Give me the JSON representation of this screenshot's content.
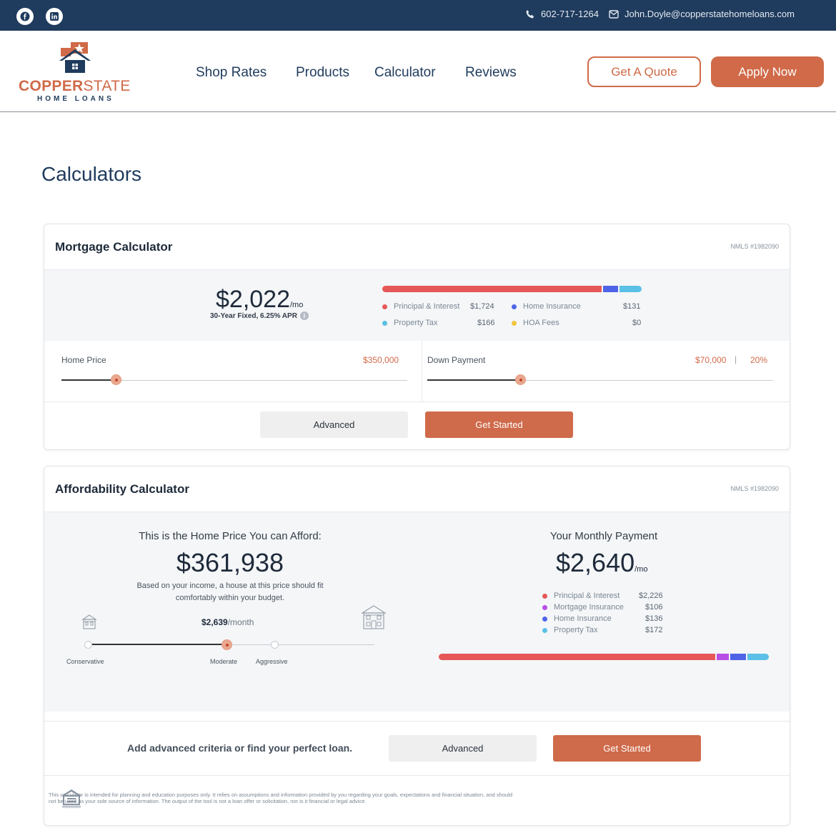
{
  "topbar": {
    "phone": "602-717-1264",
    "email": "John.Doyle@copperstatehomeloans.com"
  },
  "logo": {
    "brand_part1": "COPPER",
    "brand_part2": "STATE",
    "tagline": "HOME LOANS"
  },
  "nav": {
    "items": [
      "Shop Rates",
      "Products",
      "Calculator",
      "Reviews"
    ],
    "quote_label": "Get A Quote",
    "apply_label": "Apply Now"
  },
  "page_title": "Calculators",
  "mortgage": {
    "title": "Mortgage Calculator",
    "nmls": "NMLS #1982090",
    "payment": "$2,022",
    "payment_unit": "/mo",
    "loan_note": "30-Year Fixed, 6.25% APR",
    "breakdown": [
      {
        "label": "Principal & Interest",
        "value": "$1,724",
        "color": "#e65757"
      },
      {
        "label": "Property Tax",
        "value": "$166",
        "color": "#5bc0e6"
      },
      {
        "label": "Home Insurance",
        "value": "$131",
        "color": "#4f63e6"
      },
      {
        "label": "HOA Fees",
        "value": "$0",
        "color": "#f2c53d"
      }
    ],
    "home_price_label": "Home Price",
    "home_price_value": "$350,000",
    "home_price_slider": 0.16,
    "down_payment_label": "Down Payment",
    "down_payment_value": "$70,000",
    "down_payment_sep": "|",
    "down_payment_pct": "20%",
    "down_payment_slider": 0.27,
    "advanced_label": "Advanced",
    "start_label": "Get Started"
  },
  "affordability": {
    "title": "Affordability Calculator",
    "nmls": "NMLS #1982090",
    "afford_heading": "This is the Home Price You can Afford:",
    "afford_price": "$361,938",
    "afford_note": "Based on your income, a house at this price should fit comfortably within your budget.",
    "monthly_amount": "$2,639",
    "monthly_unit": "/month",
    "levels": [
      "Conservative",
      "Moderate",
      "Aggressive"
    ],
    "selected_level": "Moderate",
    "payment_heading": "Your Monthly Payment",
    "payment": "$2,640",
    "payment_unit": "/mo",
    "breakdown": [
      {
        "label": "Principal & Interest",
        "value": "$2,226",
        "color": "#e65757"
      },
      {
        "label": "Mortgage Insurance",
        "value": "$106",
        "color": "#b74fe6"
      },
      {
        "label": "Home Insurance",
        "value": "$136",
        "color": "#4f63e6"
      },
      {
        "label": "Property Tax",
        "value": "$172",
        "color": "#5bc0e6"
      }
    ],
    "cta_text": "Add advanced criteria or find your perfect loan.",
    "advanced_label": "Advanced",
    "start_label": "Get Started",
    "disclaimer": "This calculator is intended for planning and education purposes only. It relies on assumptions and information provided by you regarding your goals, expectations and financial situation, and should not be used as your sole source of information. The output of the tool is not a loan offer or solicitation, nor is it financial or legal advice."
  }
}
